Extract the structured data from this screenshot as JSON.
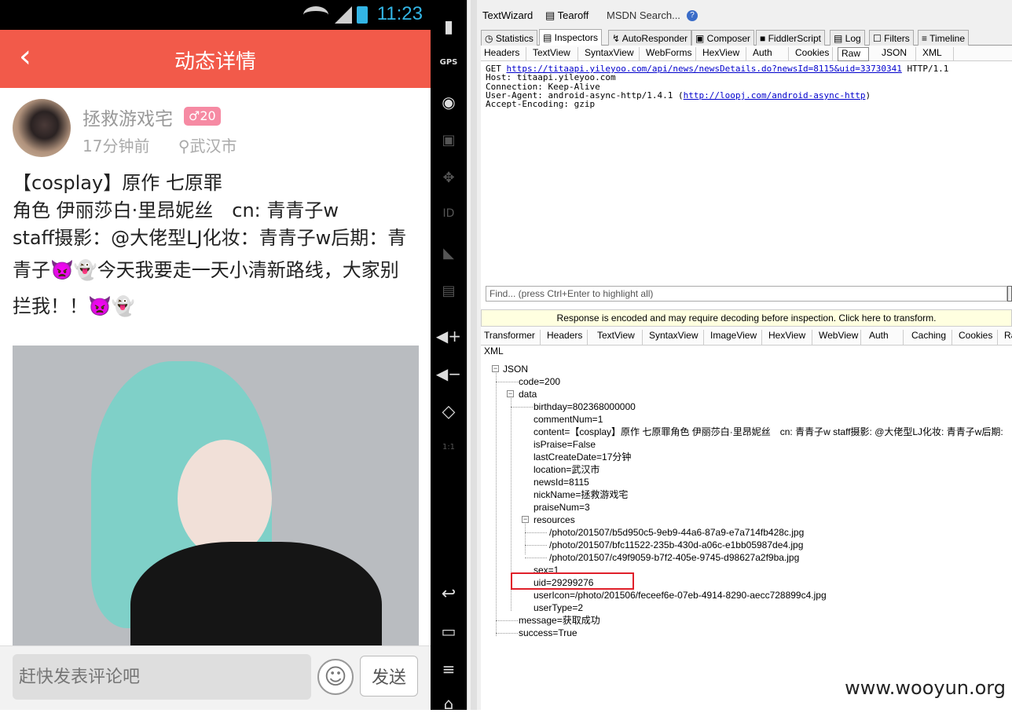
{
  "phone": {
    "status": {
      "time": "11:23"
    },
    "header": {
      "back_icon": "chevron-left-icon",
      "title": "动态详情"
    },
    "post": {
      "nickname": "拯救游戏宅",
      "level_badge": "♂20",
      "time_ago": "17分钟前",
      "location": "⚲武汉市",
      "lines": [
        "【cosplay】原作 七原罪",
        "角色 伊丽莎白·里昂妮丝　cn:  青青子w",
        "staff摄影：@大佬型LJ化妆：青青子w后期：青",
        "青子👿👻今天我要走一天小清新路线，大家别",
        "拦我！！👿👻"
      ]
    },
    "comment": {
      "placeholder": "赶快发表评论吧",
      "send_label": "发送"
    }
  },
  "emulator_bar": {
    "items": [
      "battery-icon",
      "GPS",
      "camera-icon",
      "clapper-icon",
      "dpad-icon",
      "ID",
      "rss-icon",
      "sms-icon",
      "volume-up-icon",
      "volume-down-icon",
      "rotate-icon",
      "1:1",
      "back-icon",
      "recents-icon",
      "menu-icon",
      "home-icon"
    ]
  },
  "fiddler": {
    "toolbar": [
      "TextWizard",
      "Tearoff",
      "MSDN Search..."
    ],
    "main_tabs": [
      "Statistics",
      "Inspectors",
      "AutoResponder",
      "Composer",
      "FiddlerScript",
      "Log",
      "Filters",
      "Timeline"
    ],
    "request_tabs": [
      "Headers",
      "TextView",
      "SyntaxView",
      "WebForms",
      "HexView",
      "Auth",
      "Cookies",
      "Raw",
      "JSON",
      "XML"
    ],
    "raw": {
      "method": "GET ",
      "url": "https://titaapi.yileyoo.com/api/news/newsDetails.do?newsId=8115&uid=33730341",
      "protocol": " HTTP/1.1",
      "host": "Host: titaapi.yileyoo.com",
      "connection": "Connection: Keep-Alive",
      "user_agent_prefix": "User-Agent: android-async-http/1.4.1 (",
      "user_agent_link": "http://loopj.com/android-async-http",
      "user_agent_suffix": ")",
      "accept": "Accept-Encoding: gzip"
    },
    "find_placeholder": "Find... (press Ctrl+Enter to highlight all)",
    "notice": "Response is encoded and may require decoding before inspection. Click here to transform.",
    "response_tabs": [
      "Transformer",
      "Headers",
      "TextView",
      "SyntaxView",
      "ImageView",
      "HexView",
      "WebView",
      "Auth",
      "Caching",
      "Cookies",
      "Ra"
    ],
    "xml_tab": "XML",
    "tree": {
      "root": "JSON",
      "code": "code=200",
      "data": "data",
      "birthday": "birthday=802368000000",
      "commentNum": "commentNum=1",
      "content": "content=【cosplay】原作 七原罪角色 伊丽莎白·里昂妮丝　cn: 青青子w staff摄影: @大佬型LJ化妆: 青青子w后期:",
      "isPraise": "isPraise=False",
      "lastCreateDate": "lastCreateDate=17分钟",
      "location": "location=武汉市",
      "newsId": "newsId=8115",
      "nickName": "nickName=拯救游戏宅",
      "praiseNum": "praiseNum=3",
      "resources": "resources",
      "res1": "/photo/201507/b5d950c5-9eb9-44a6-87a9-e7a714fb428c.jpg",
      "res2": "/photo/201507/bfc11522-235b-430d-a06c-e1bb05987de4.jpg",
      "res3": "/photo/201507/c49f9059-b7f2-405e-9745-d98627a2f9ba.jpg",
      "sex": "sex=1",
      "uid": "uid=29299276",
      "userIcon": "userIcon=/photo/201506/feceef6e-07eb-4914-8290-aecc728899c4.jpg",
      "userType": "userType=2",
      "message": "message=获取成功",
      "success": "success=True"
    }
  },
  "watermark": "www.wooyun.org"
}
